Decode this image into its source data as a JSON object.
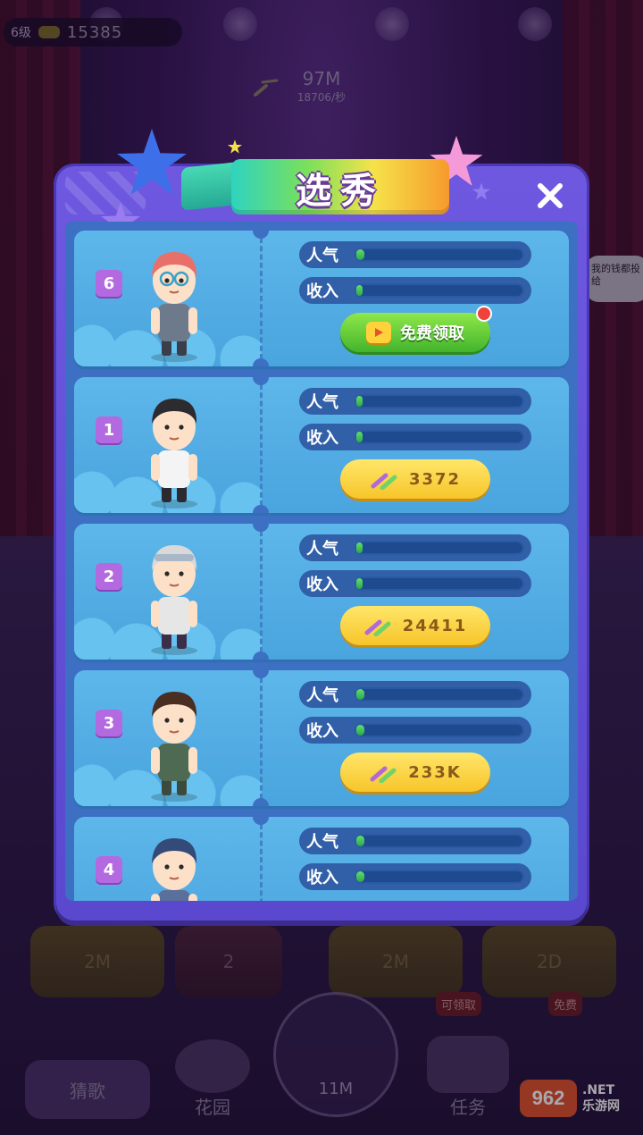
{
  "hud": {
    "level_label": "6级",
    "coins": "15385",
    "income_total": "97M",
    "income_rate": "18706/秒"
  },
  "background": {
    "speech_bubble": "我的钱都投给",
    "pedestals": [
      "2M",
      "2M",
      "2D"
    ],
    "pedestal_badge": "2",
    "center_value": "11M",
    "nav_guess": "猜歌",
    "nav_garden": "花园",
    "nav_task": "任务",
    "badge_left": "可领取",
    "badge_right": "免费"
  },
  "modal": {
    "title": "选秀",
    "close_icon": "close-icon",
    "stat_labels": {
      "popularity": "人气",
      "income": "收入"
    },
    "free_button_label": "免费领取",
    "candidates": [
      {
        "rank": "6",
        "popularity": 0.05,
        "income": 0.04,
        "action": "free",
        "price": ""
      },
      {
        "rank": "1",
        "popularity": 0.04,
        "income": 0.04,
        "action": "buy",
        "price": "3372"
      },
      {
        "rank": "2",
        "popularity": 0.04,
        "income": 0.04,
        "action": "buy",
        "price": "24411"
      },
      {
        "rank": "3",
        "popularity": 0.05,
        "income": 0.05,
        "action": "buy",
        "price": "233K"
      },
      {
        "rank": "4",
        "popularity": 0.05,
        "income": 0.05,
        "action": "buy",
        "price": ""
      }
    ]
  },
  "watermark": {
    "logo": "962",
    "suffix": ".NET",
    "sub": "乐游网"
  },
  "colors": {
    "modal_bg": "#6e58e0",
    "card_bg": "#5db7ea",
    "bar_fill": "#43c85a",
    "free_button": "#5cc93a",
    "buy_button": "#f9d23c",
    "rank_badge": "#b36ae0"
  }
}
